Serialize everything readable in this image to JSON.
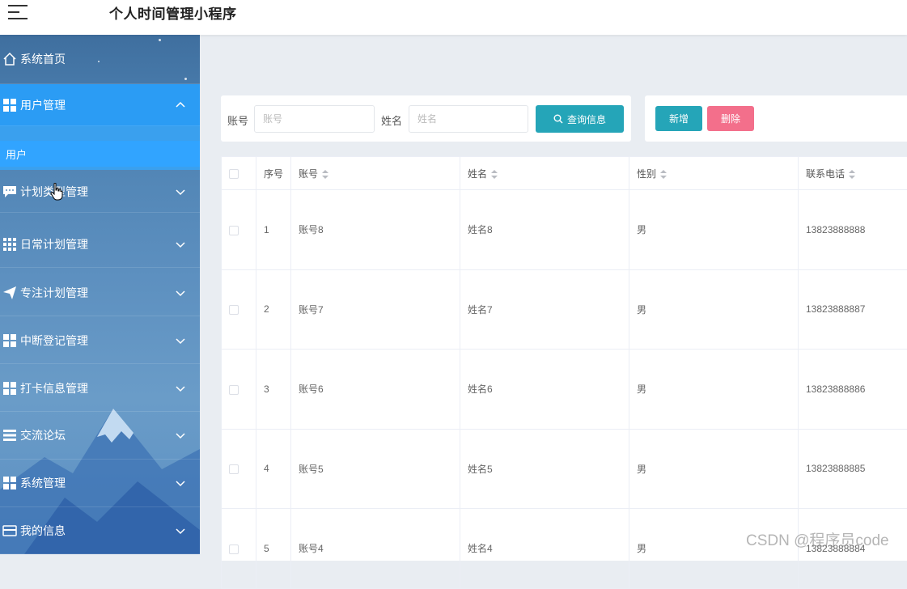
{
  "header": {
    "title": "个人时间管理小程序"
  },
  "sidebar": {
    "items": [
      {
        "label": "系统首页",
        "icon": "home-icon"
      },
      {
        "label": "用户管理",
        "icon": "grid-icon",
        "expanded": true
      },
      {
        "label": "计划类型管理",
        "icon": "chat-icon"
      },
      {
        "label": "日常计划管理",
        "icon": "apps-icon"
      },
      {
        "label": "专注计划管理",
        "icon": "send-icon"
      },
      {
        "label": "中断登记管理",
        "icon": "grid-icon"
      },
      {
        "label": "打卡信息管理",
        "icon": "grid-icon"
      },
      {
        "label": "交流论坛",
        "icon": "list-icon"
      },
      {
        "label": "系统管理",
        "icon": "grid-icon"
      },
      {
        "label": "我的信息",
        "icon": "card-icon"
      }
    ],
    "submenu": {
      "label": "用户"
    }
  },
  "search": {
    "account_label": "账号",
    "account_placeholder": "账号",
    "account_value": "",
    "name_label": "姓名",
    "name_placeholder": "姓名",
    "name_value": "",
    "button_label": "查询信息"
  },
  "actions": {
    "add_label": "新增",
    "delete_label": "删除"
  },
  "table": {
    "columns": [
      "序号",
      "账号",
      "姓名",
      "性别",
      "联系电话"
    ],
    "rows": [
      [
        "1",
        "账号8",
        "姓名8",
        "男",
        "13823888888"
      ],
      [
        "2",
        "账号7",
        "姓名7",
        "男",
        "13823888887"
      ],
      [
        "3",
        "账号6",
        "姓名6",
        "男",
        "13823888886"
      ],
      [
        "4",
        "账号5",
        "姓名5",
        "男",
        "13823888885"
      ],
      [
        "5",
        "账号4",
        "姓名4",
        "男",
        "13823888884"
      ]
    ]
  },
  "watermark": "CSDN @程序员code",
  "colors": {
    "accent": "#25a5b8",
    "danger": "#f36f8b",
    "menu_active": "#2b9cf4",
    "sidebar_top": "#3f6f9f",
    "sidebar_bottom": "#5b8fc2"
  }
}
